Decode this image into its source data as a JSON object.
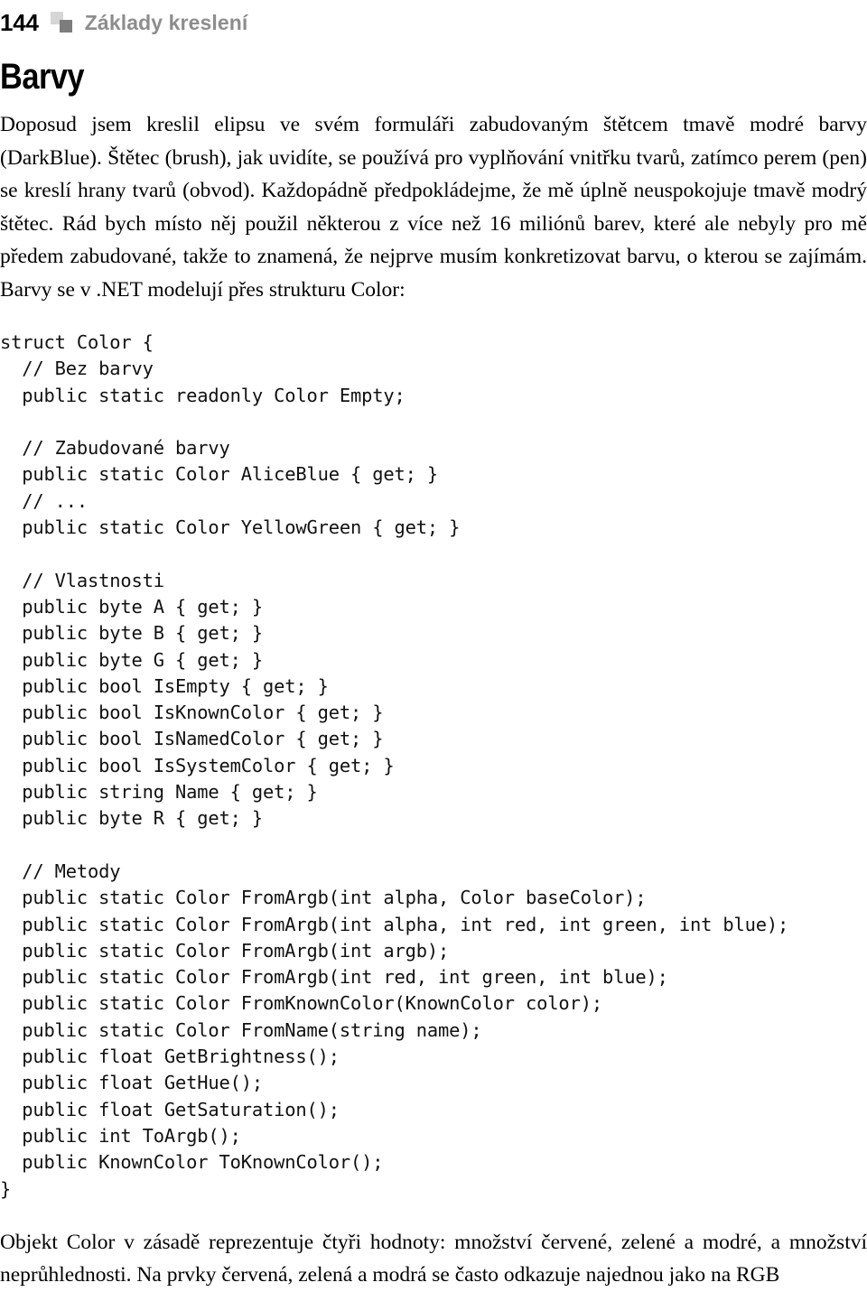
{
  "running_head": {
    "folio": "144",
    "title": "Základy kreslení",
    "mark_icon": "two-squares-icon",
    "colors": {
      "title": "#8d8d8d",
      "square_light": "#d6d6d6",
      "square_dark": "#7d7d7d"
    }
  },
  "chapter": {
    "title": "Barvy"
  },
  "body": {
    "intro_paragraph": "Doposud jsem kreslil elipsu ve svém formuláři zabudovaným štětcem tmavě modré barvy (DarkBlue). Štětec (brush), jak uvidíte, se používá pro vyplňování vnitřku tvarů, zatímco perem (pen) se kreslí hrany tvarů (obvod). Každopádně předpokládejme, že mě úplně neuspokojuje tmavě modrý štětec. Rád bych místo něj použil některou z více než 16 miliónů barev, které ale nebyly pro mě předem zabudované, takže to znamená, že nejprve musím konkretizovat barvu, o kterou se zajímám. Barvy se v .NET modelují přes strukturu Color:",
    "closing_paragraph": "Objekt Color v zásadě reprezentuje čtyři hodnoty: množství červené, zelené a modré, a množství neprůhlednosti. Na prvky červená, zelená a modrá se často odkazuje najednou jako na RGB"
  },
  "code": {
    "language": "csharp",
    "lines": [
      "struct Color {",
      "  // Bez barvy",
      "  public static readonly Color Empty;",
      "",
      "  // Zabudované barvy",
      "  public static Color AliceBlue { get; }",
      "  // ...",
      "  public static Color YellowGreen { get; }",
      "",
      "  // Vlastnosti",
      "  public byte A { get; }",
      "  public byte B { get; }",
      "  public byte G { get; }",
      "  public bool IsEmpty { get; }",
      "  public bool IsKnownColor { get; }",
      "  public bool IsNamedColor { get; }",
      "  public bool IsSystemColor { get; }",
      "  public string Name { get; }",
      "  public byte R { get; }",
      "",
      "  // Metody",
      "  public static Color FromArgb(int alpha, Color baseColor);",
      "  public static Color FromArgb(int alpha, int red, int green, int blue);",
      "  public static Color FromArgb(int argb);",
      "  public static Color FromArgb(int red, int green, int blue);",
      "  public static Color FromKnownColor(KnownColor color);",
      "  public static Color FromName(string name);",
      "  public float GetBrightness();",
      "  public float GetHue();",
      "  public float GetSaturation();",
      "  public int ToArgb();",
      "  public KnownColor ToKnownColor();",
      "}"
    ]
  }
}
